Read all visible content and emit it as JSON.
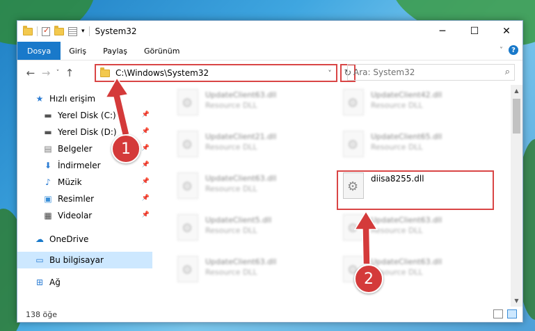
{
  "window": {
    "title": "System32",
    "controls": {
      "minimize": "─",
      "maximize": "☐",
      "close": "✕"
    }
  },
  "quick_access_toolbar": [
    "folder-icon",
    "properties-check-icon",
    "new-folder-icon",
    "customize-icon"
  ],
  "ribbon": {
    "tabs": [
      {
        "label": "Dosya",
        "active": true
      },
      {
        "label": "Giriş",
        "active": false
      },
      {
        "label": "Paylaş",
        "active": false
      },
      {
        "label": "Görünüm",
        "active": false
      }
    ],
    "expand": "˅",
    "help": "?"
  },
  "navigation": {
    "back": "←",
    "forward": "→",
    "recent": "˅",
    "up": "↑"
  },
  "address_bar": {
    "path": "C:\\Windows\\System32",
    "dropdown": "˅",
    "refresh": "↻"
  },
  "search": {
    "placeholder": "Ara: System32",
    "icon": "search-icon"
  },
  "sidebar": {
    "items": [
      {
        "label": "Hızlı erişim",
        "icon": "star-icon",
        "glyph": "★",
        "pinned": false,
        "top": true
      },
      {
        "label": "Yerel Disk (C:)",
        "icon": "drive-icon",
        "glyph": "▬",
        "pinned": true
      },
      {
        "label": "Yerel Disk (D:)",
        "icon": "drive-icon",
        "glyph": "▬",
        "pinned": true
      },
      {
        "label": "Belgeler",
        "icon": "document-icon",
        "glyph": "▤",
        "pinned": true
      },
      {
        "label": "İndirmeler",
        "icon": "download-icon",
        "glyph": "⬇",
        "pinned": true
      },
      {
        "label": "Müzik",
        "icon": "music-icon",
        "glyph": "♪",
        "pinned": true
      },
      {
        "label": "Resimler",
        "icon": "pictures-icon",
        "glyph": "▣",
        "pinned": true
      },
      {
        "label": "Videolar",
        "icon": "video-icon",
        "glyph": "▦",
        "pinned": true
      },
      {
        "label": "OneDrive",
        "icon": "cloud-icon",
        "glyph": "☁",
        "pinned": false,
        "top": true
      },
      {
        "label": "Bu bilgisayar",
        "icon": "computer-icon",
        "glyph": "▭",
        "pinned": false,
        "top": true,
        "selected": true
      },
      {
        "label": "Ağ",
        "icon": "network-icon",
        "glyph": "⊞",
        "pinned": false,
        "top": true
      }
    ]
  },
  "files": [
    {
      "name": "UpdateClient63.dll",
      "desc": "Resource DLL",
      "blurred": true
    },
    {
      "name": "UpdateClient42.dll",
      "desc": "Resource DLL",
      "blurred": true
    },
    {
      "name": "UpdateClient21.dll",
      "desc": "Resource DLL",
      "blurred": true
    },
    {
      "name": "UpdateClient65.dll",
      "desc": "Resource DLL",
      "blurred": true
    },
    {
      "name": "UpdateClient63.dll",
      "desc": "Resource DLL",
      "blurred": true
    },
    {
      "name": "diisa8255.dll",
      "desc": "",
      "blurred": false
    },
    {
      "name": "UpdateClient5.dll",
      "desc": "Resource DLL",
      "blurred": true
    },
    {
      "name": "UpdateClient63.dll",
      "desc": "Resource DLL",
      "blurred": true
    },
    {
      "name": "UpdateClient63.dll",
      "desc": "Resource DLL",
      "blurred": true
    },
    {
      "name": "UpdateClient63.dll",
      "desc": "Resource DLL",
      "blurred": true
    }
  ],
  "status": {
    "item_count": "138 öğe"
  },
  "callouts": [
    {
      "number": "1"
    },
    {
      "number": "2"
    }
  ],
  "colors": {
    "accent": "#1979ca",
    "callout": "#d43a3a",
    "selection": "#cde8ff"
  }
}
